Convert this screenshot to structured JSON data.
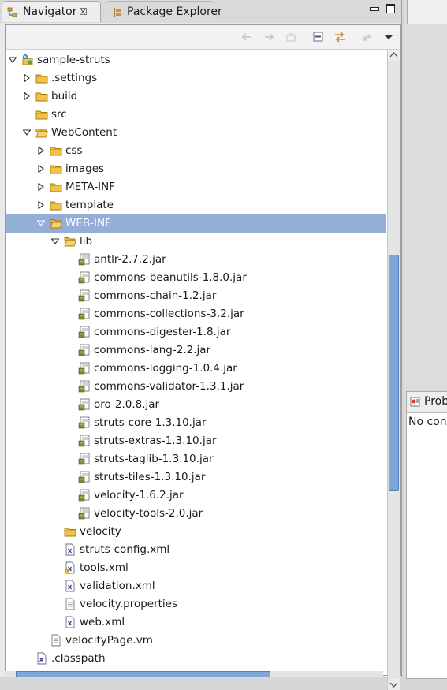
{
  "tabs": {
    "navigator": "Navigator",
    "package_explorer": "Package Explorer"
  },
  "tree": [
    {
      "label": "sample-struts",
      "depth": 0,
      "twisty": "open",
      "icon": "project-icon"
    },
    {
      "label": ".settings",
      "depth": 1,
      "twisty": "closed",
      "icon": "folder-icon"
    },
    {
      "label": "build",
      "depth": 1,
      "twisty": "closed",
      "icon": "folder-icon"
    },
    {
      "label": "src",
      "depth": 1,
      "twisty": "none",
      "icon": "folder-icon"
    },
    {
      "label": "WebContent",
      "depth": 1,
      "twisty": "open",
      "icon": "folder-open-icon"
    },
    {
      "label": "css",
      "depth": 2,
      "twisty": "closed",
      "icon": "folder-icon"
    },
    {
      "label": "images",
      "depth": 2,
      "twisty": "closed",
      "icon": "folder-icon"
    },
    {
      "label": "META-INF",
      "depth": 2,
      "twisty": "closed",
      "icon": "folder-icon"
    },
    {
      "label": "template",
      "depth": 2,
      "twisty": "closed",
      "icon": "folder-icon"
    },
    {
      "label": "WEB-INF",
      "depth": 2,
      "twisty": "open",
      "icon": "folder-open-icon",
      "selected": true
    },
    {
      "label": "lib",
      "depth": 3,
      "twisty": "open",
      "icon": "folder-open-icon"
    },
    {
      "label": "antlr-2.7.2.jar",
      "depth": 4,
      "twisty": "none",
      "icon": "jar-icon"
    },
    {
      "label": "commons-beanutils-1.8.0.jar",
      "depth": 4,
      "twisty": "none",
      "icon": "jar-icon"
    },
    {
      "label": "commons-chain-1.2.jar",
      "depth": 4,
      "twisty": "none",
      "icon": "jar-icon"
    },
    {
      "label": "commons-collections-3.2.jar",
      "depth": 4,
      "twisty": "none",
      "icon": "jar-icon"
    },
    {
      "label": "commons-digester-1.8.jar",
      "depth": 4,
      "twisty": "none",
      "icon": "jar-icon"
    },
    {
      "label": "commons-lang-2.2.jar",
      "depth": 4,
      "twisty": "none",
      "icon": "jar-icon"
    },
    {
      "label": "commons-logging-1.0.4.jar",
      "depth": 4,
      "twisty": "none",
      "icon": "jar-icon"
    },
    {
      "label": "commons-validator-1.3.1.jar",
      "depth": 4,
      "twisty": "none",
      "icon": "jar-icon"
    },
    {
      "label": "oro-2.0.8.jar",
      "depth": 4,
      "twisty": "none",
      "icon": "jar-icon"
    },
    {
      "label": "struts-core-1.3.10.jar",
      "depth": 4,
      "twisty": "none",
      "icon": "jar-icon"
    },
    {
      "label": "struts-extras-1.3.10.jar",
      "depth": 4,
      "twisty": "none",
      "icon": "jar-icon"
    },
    {
      "label": "struts-taglib-1.3.10.jar",
      "depth": 4,
      "twisty": "none",
      "icon": "jar-icon"
    },
    {
      "label": "struts-tiles-1.3.10.jar",
      "depth": 4,
      "twisty": "none",
      "icon": "jar-icon"
    },
    {
      "label": "velocity-1.6.2.jar",
      "depth": 4,
      "twisty": "none",
      "icon": "jar-icon"
    },
    {
      "label": "velocity-tools-2.0.jar",
      "depth": 4,
      "twisty": "none",
      "icon": "jar-icon"
    },
    {
      "label": "velocity",
      "depth": 3,
      "twisty": "none",
      "icon": "folder-icon"
    },
    {
      "label": "struts-config.xml",
      "depth": 3,
      "twisty": "none",
      "icon": "xml-file-icon"
    },
    {
      "label": "tools.xml",
      "depth": 3,
      "twisty": "none",
      "icon": "xml-warning-icon"
    },
    {
      "label": "validation.xml",
      "depth": 3,
      "twisty": "none",
      "icon": "xml-file-icon"
    },
    {
      "label": "velocity.properties",
      "depth": 3,
      "twisty": "none",
      "icon": "text-file-icon"
    },
    {
      "label": "web.xml",
      "depth": 3,
      "twisty": "none",
      "icon": "xml-file-icon"
    },
    {
      "label": "velocityPage.vm",
      "depth": 2,
      "twisty": "none",
      "icon": "text-file-icon"
    },
    {
      "label": ".classpath",
      "depth": 1,
      "twisty": "none",
      "icon": "xml-file-icon"
    }
  ],
  "problems": {
    "tab_label": "Prob",
    "message": "No cons"
  }
}
